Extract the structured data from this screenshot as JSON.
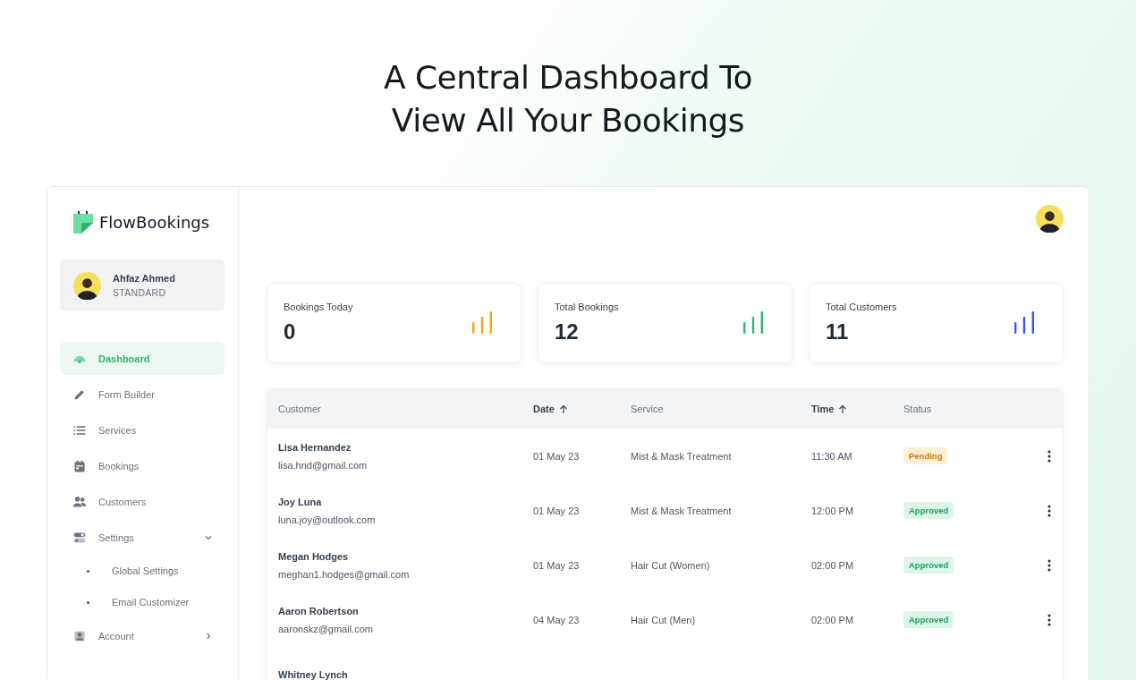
{
  "headline": [
    "A Central Dashboard To",
    "View All Your Bookings"
  ],
  "sidebar": {
    "logo": "FlowBookings",
    "user": {
      "name": "Ahfaz Ahmed",
      "plan": "STANDARD"
    },
    "items": [
      {
        "label": "Dashboard",
        "selected": true
      },
      {
        "label": "Form Builder",
        "selected": false
      },
      {
        "label": "Services",
        "selected": false
      },
      {
        "label": "Bookings",
        "selected": false
      },
      {
        "label": "Customers",
        "selected": false
      },
      {
        "label": "Settings",
        "selected": false,
        "expanded": true,
        "children": [
          {
            "label": "Global Settings",
            "selected": false
          },
          {
            "label": "Email Customizer",
            "selected": false
          }
        ]
      },
      {
        "label": "Account",
        "selected": false,
        "expanded": false
      }
    ]
  },
  "stats": [
    {
      "label": "Bookings Today",
      "value": "0",
      "color": "#f5a70a"
    },
    {
      "label": "Total Bookings",
      "value": "12",
      "color": "#2fb574"
    },
    {
      "label": "Total Customers",
      "value": "11",
      "color": "#2f5ff5"
    }
  ],
  "table": {
    "columns": [
      {
        "label": "Customer",
        "sorted": false
      },
      {
        "label": "Date",
        "sorted": true
      },
      {
        "label": "Service",
        "sorted": false
      },
      {
        "label": "Time",
        "sorted": true
      },
      {
        "label": "Status",
        "sorted": false
      }
    ],
    "rows": [
      {
        "name": "Lisa Hernandez",
        "email": "lisa.hnd@gmail.com",
        "date": "01 May 23",
        "service": "Mist & Mask Treatment",
        "time": "11:30 AM",
        "status": "Pending",
        "pending": true
      },
      {
        "name": "Joy Luna",
        "email": "luna.joy@outlook.com",
        "date": "01 May 23",
        "service": "Mist & Mask Treatment",
        "time": "12:00 PM",
        "status": "Approved",
        "pending": false
      },
      {
        "name": "Megan Hodges",
        "email": "meghan1.hodges@gmail.com",
        "date": "01 May 23",
        "service": "Hair Cut (Women)",
        "time": "02:00 PM",
        "status": "Approved",
        "pending": false
      },
      {
        "name": "Aaron Robertson",
        "email": "aaronskz@gmail.com",
        "date": "04 May 23",
        "service": "Hair Cut (Men)",
        "time": "02:00 PM",
        "status": "Approved",
        "pending": false
      },
      {
        "name": "Whitney Lynch"
      }
    ]
  }
}
